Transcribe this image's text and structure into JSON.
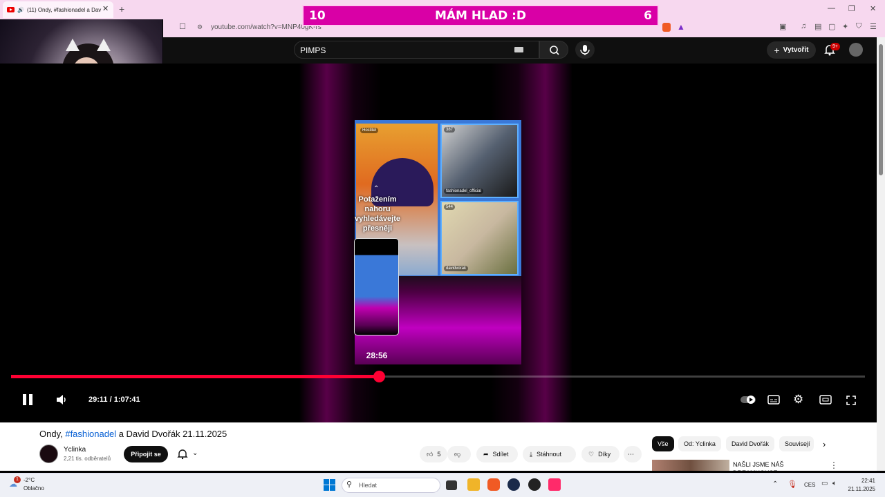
{
  "browser": {
    "tab_title": "(11) Ondy, #fashionadel a Dav",
    "url": "youtube.com/watch?v=MNP40gK-rs"
  },
  "overlay": {
    "left_number": "10",
    "title": "MÁM HLAD :D",
    "right_number": "6"
  },
  "youtube_header": {
    "search_value": "PIMPS",
    "create_label": "Vytvořit",
    "notification_count": "9+"
  },
  "player": {
    "video_labels": {
      "host": "Hostitel",
      "viewer1_count": "387",
      "viewer1_name": "fashionadel_official",
      "viewer2_count": "544",
      "viewer2_name": "davidvorak"
    },
    "hint_text": "Potažením nahoru vyhledávejte přesněji",
    "preview_time": "28:56",
    "current_time": "29:11",
    "duration": "1:07:41",
    "time_display": "29:11 / 1:07:41",
    "progress_fraction": 0.431
  },
  "video_info": {
    "title_prefix": "Ondy, ",
    "title_hashtag": "#fashionadel",
    "title_suffix": " a David Dvořák 21.11.2025",
    "channel_name": "Yclinka",
    "subscribers": "2,21 tis. odběratelů",
    "subscribe_label": "Připojit se",
    "like_count": "5",
    "share_label": "Sdílet",
    "download_label": "Stáhnout",
    "thanks_label": "Díky"
  },
  "sidebar": {
    "chips": [
      "Vše",
      "Od: Yclinka",
      "David Dvořák",
      "Souvisejí"
    ],
    "recommendation_title": "NAŠLI JSME NÁŠ DREAMHOUSE"
  },
  "taskbar": {
    "weather_badge": "1",
    "temperature": "-2°C",
    "weather_desc": "Oblačno",
    "search_placeholder": "Hledat",
    "language": "CES",
    "time": "22:41",
    "date": "21.11.2025"
  },
  "colors": {
    "accent_red": "#ff0033",
    "overlay_magenta": "#d900a6",
    "link_blue": "#065fd4"
  }
}
